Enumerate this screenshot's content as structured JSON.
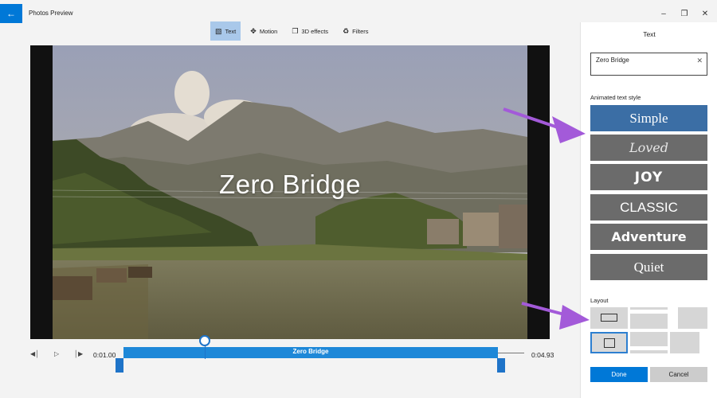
{
  "window": {
    "title": "Photos Preview"
  },
  "toolbar": {
    "items": [
      {
        "label": "Text",
        "icon": "text-box-icon",
        "active": true
      },
      {
        "label": "Motion",
        "icon": "motion-icon",
        "active": false
      },
      {
        "label": "3D effects",
        "icon": "3d-effects-icon",
        "active": false
      },
      {
        "label": "Filters",
        "icon": "filters-icon",
        "active": false
      }
    ]
  },
  "preview": {
    "overlay_text": "Zero Bridge"
  },
  "timeline": {
    "start_time": "0:01.00",
    "end_time": "0:04.93",
    "clip_label": "Zero Bridge"
  },
  "panel": {
    "title": "Text",
    "text_value": "Zero Bridge",
    "style_section_label": "Animated text style",
    "styles": [
      "Simple",
      "Loved",
      "JOY",
      "CLASSIC",
      "Adventure",
      "Quiet"
    ],
    "selected_style": "Simple",
    "layout_section_label": "Layout",
    "done_label": "Done",
    "cancel_label": "Cancel"
  },
  "colors": {
    "accent": "#0078d7",
    "selected_style": "#3b6ea5",
    "style_tile": "#6b6b6b",
    "annotation_arrow": "#a35ad9"
  }
}
